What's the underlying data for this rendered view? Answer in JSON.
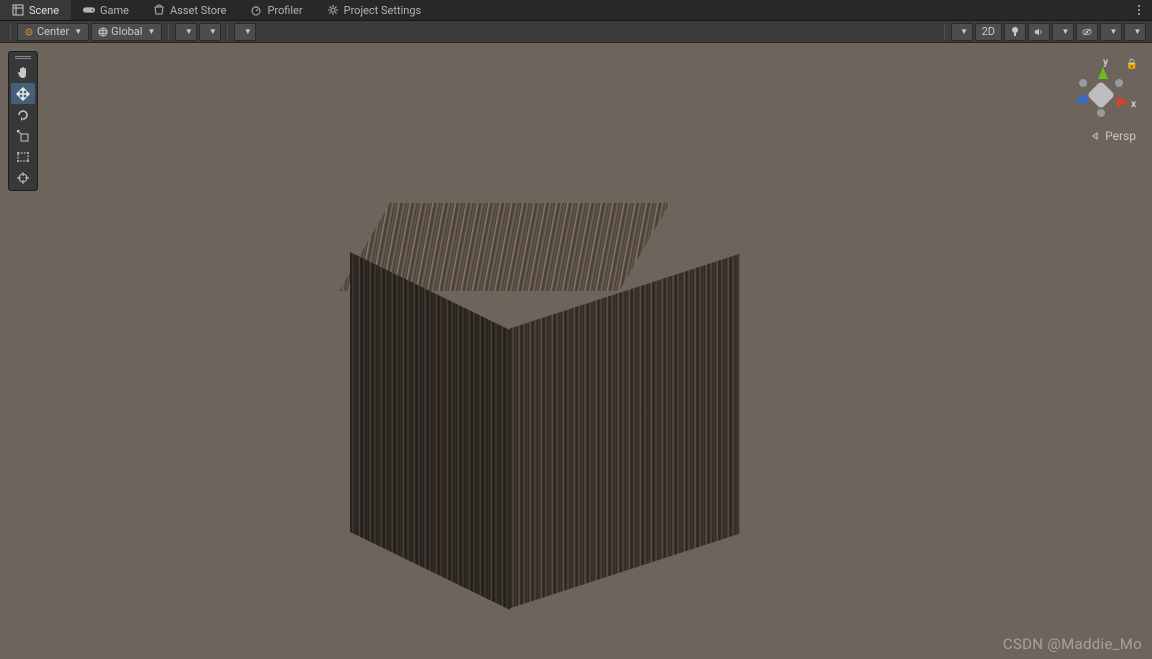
{
  "tabs": {
    "scene": "Scene",
    "game": "Game",
    "asset_store": "Asset Store",
    "profiler": "Profiler",
    "project_settings": "Project Settings"
  },
  "toolbar": {
    "pivot_mode": "Center",
    "space_mode": "Global",
    "mode_2d": "2D"
  },
  "gizmo": {
    "axis_x": "x",
    "axis_y": "y",
    "persp": "Persp"
  },
  "watermark": "CSDN @Maddie_Mo"
}
